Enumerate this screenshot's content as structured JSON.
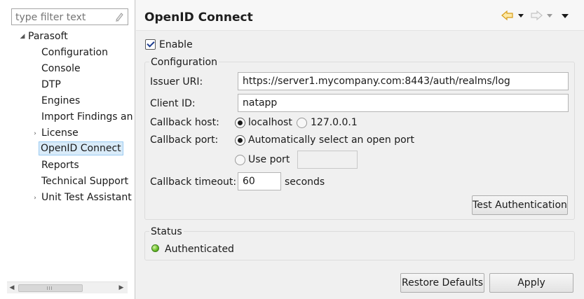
{
  "nav": {
    "filter_placeholder": "type filter text",
    "tree": {
      "root": "Parasoft",
      "items": [
        "Configuration",
        "Console",
        "DTP",
        "Engines",
        "Import Findings an",
        "License",
        "OpenID Connect",
        "Reports",
        "Technical Support",
        "Unit Test Assistant"
      ],
      "selected": "OpenID Connect"
    }
  },
  "page": {
    "title": "OpenID Connect",
    "enable_label": "Enable",
    "enable_checked": true,
    "configuration": {
      "group_title": "Configuration",
      "issuer_uri_label": "Issuer URI:",
      "issuer_uri_value": "https://server1.mycompany.com:8443/auth/realms/log",
      "client_id_label": "Client ID:",
      "client_id_value": "natapp",
      "callback_host_label": "Callback host:",
      "host_options": [
        "localhost",
        "127.0.0.1"
      ],
      "host_selected": "localhost",
      "callback_port_label": "Callback port:",
      "port_option_auto": "Automatically select an open port",
      "port_option_use": "Use port",
      "port_selected": "auto",
      "use_port_value": "",
      "callback_timeout_label": "Callback timeout:",
      "callback_timeout_value": "60",
      "timeout_unit": "seconds",
      "test_button": "Test Authentication"
    },
    "status": {
      "group_title": "Status",
      "text": "Authenticated",
      "color": "#6bbf2a"
    },
    "buttons": {
      "restore_defaults": "Restore Defaults",
      "apply": "Apply"
    }
  },
  "icons": {
    "back": "back-arrow-icon",
    "forward": "forward-arrow-icon",
    "menu": "view-menu-icon",
    "clear_filter": "clear-filter-icon"
  },
  "colors": {
    "selection_bg": "#d9ebf9",
    "nav_arrow_active": "#e8a524"
  }
}
